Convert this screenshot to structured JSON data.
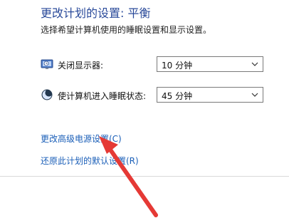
{
  "header": {
    "title": "更改计划的设置: 平衡",
    "subtitle": "选择希望计算机使用的睡眠设置和显示设置。"
  },
  "settings": [
    {
      "label": "关闭显示器:",
      "value": "10 分钟",
      "icon": "monitor-clock-icon"
    },
    {
      "label": "使计算机进入睡眠状态:",
      "value": "45 分钟",
      "icon": "moon-sleep-icon"
    }
  ],
  "links": {
    "advanced": "更改高级电源设置(C)",
    "restore": "还原此计划的默认设置(R)"
  },
  "annotation": {
    "arrow_color": "#e53935"
  }
}
